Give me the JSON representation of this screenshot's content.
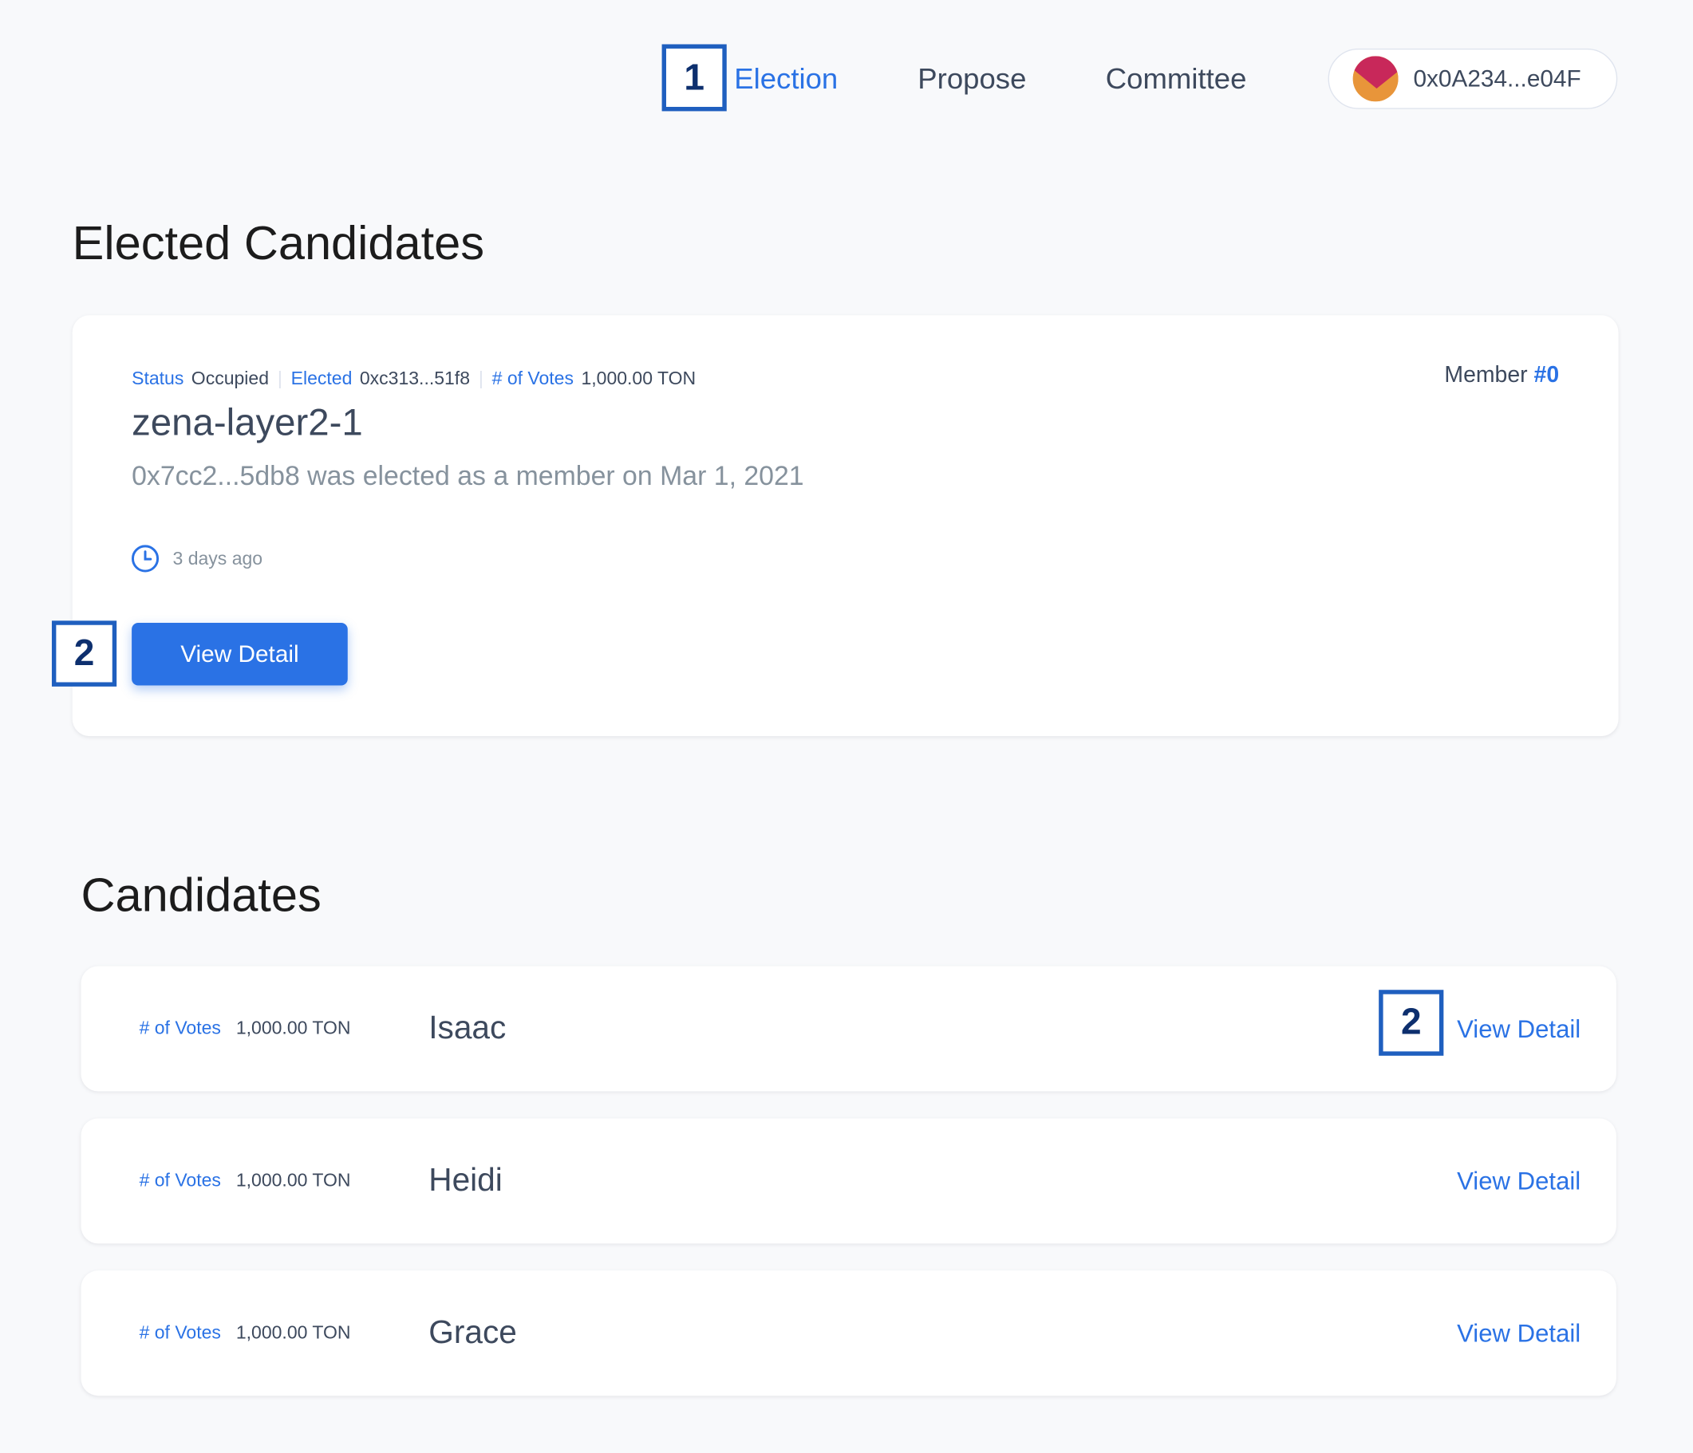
{
  "nav": {
    "items": [
      {
        "label": "Election",
        "active": true
      },
      {
        "label": "Propose",
        "active": false
      },
      {
        "label": "Committee",
        "active": false
      }
    ],
    "wallet_address": "0x0A234...e04F"
  },
  "annotations": [
    "1",
    "2",
    "2"
  ],
  "elected": {
    "section_title": "Elected Candidates",
    "status_label": "Status",
    "status_value": "Occupied",
    "elected_label": "Elected",
    "elected_value": "0xc313...51f8",
    "votes_label": "# of Votes",
    "votes_value": "1,000.00 TON",
    "member_label": "Member",
    "member_number": "#0",
    "name": "zena-layer2-1",
    "description": "0x7cc2...5db8 was elected as a member on Mar 1, 2021",
    "time_ago": "3 days ago",
    "button_label": "View Detail"
  },
  "candidates": {
    "section_title": "Candidates",
    "rows": [
      {
        "votes_label": "# of Votes",
        "votes_value": "1,000.00 TON",
        "name": "Isaac",
        "link_label": "View Detail"
      },
      {
        "votes_label": "# of Votes",
        "votes_value": "1,000.00 TON",
        "name": "Heidi",
        "link_label": "View Detail"
      },
      {
        "votes_label": "# of Votes",
        "votes_value": "1,000.00 TON",
        "name": "Grace",
        "link_label": "View Detail"
      }
    ]
  },
  "colors": {
    "accent": "#2a72e5",
    "text": "#3d495d",
    "muted": "#86929d",
    "background": "#f8f9fb",
    "annotation_border": "#1f5fbf"
  },
  "icons": {
    "clock": "clock-icon",
    "avatar": "wallet-avatar-icon"
  }
}
